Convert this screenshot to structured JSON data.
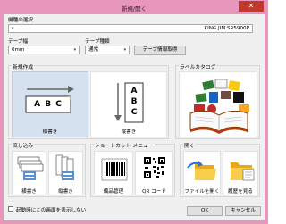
{
  "window": {
    "title": "新規/開く",
    "close_glyph": "✕"
  },
  "printer": {
    "label": "機種の選択",
    "value": "KING JIM SR5900P"
  },
  "tape_width": {
    "label": "テープ幅",
    "value": "6mm"
  },
  "tape_type": {
    "label": "テープ種類",
    "value": "通常",
    "button": "テープ情報取得"
  },
  "new_create": {
    "label": "新規作成",
    "horizontal": {
      "caption": "横書き",
      "letters": "A B C"
    },
    "vertical": {
      "caption": "縦書き",
      "letters": [
        "A",
        "B",
        "C"
      ]
    }
  },
  "label_catalog": {
    "label": "ラベルカタログ"
  },
  "pour": {
    "label": "流し込み",
    "horizontal": "横書き",
    "vertical": "縦書き"
  },
  "shortcut": {
    "label": "ショートカット メニュー",
    "equipment": "備品管理",
    "qr": "QR コード"
  },
  "open": {
    "label": "開く",
    "file_open": "ファイルを開く",
    "history": "履歴を見る"
  },
  "startup": {
    "label": "起動時にこの画面を表示しない",
    "checked": false
  },
  "footer": {
    "ok": "OK",
    "cancel": "キャンセル"
  }
}
